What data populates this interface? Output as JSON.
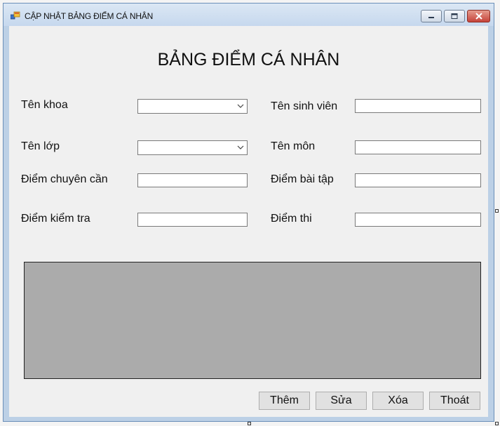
{
  "window": {
    "title": "CẬP NHẬT BẢNG ĐIỂM CÁ NHÂN"
  },
  "form": {
    "heading": "BẢNG ĐIỂM CÁ NHÂN",
    "labels": {
      "khoa": "Tên khoa",
      "sinh_vien": "Tên sinh viên",
      "lop": "Tên lớp",
      "mon": "Tên môn",
      "chuyen_can": "Điểm chuyên cần",
      "bai_tap": "Điểm bài tập",
      "kiem_tra": "Điểm kiểm tra",
      "thi": "Điểm thi"
    },
    "values": {
      "khoa": "",
      "sinh_vien": "",
      "lop": "",
      "mon": "",
      "chuyen_can": "",
      "bai_tap": "",
      "kiem_tra": "",
      "thi": ""
    }
  },
  "buttons": {
    "add": "Thêm",
    "edit": "Sửa",
    "delete": "Xóa",
    "exit": "Thoát"
  },
  "icons": {
    "app": "form-app-icon",
    "minimize": "minimize-icon",
    "maximize": "maximize-icon",
    "close": "close-icon",
    "dropdown": "chevron-down-icon"
  },
  "colors": {
    "title_bar": "#c6d8ee",
    "client_bg": "#f0f0f0",
    "grid_bg": "#ababab",
    "button_bg": "#e1e1e1",
    "close_button": "#c6433a"
  }
}
